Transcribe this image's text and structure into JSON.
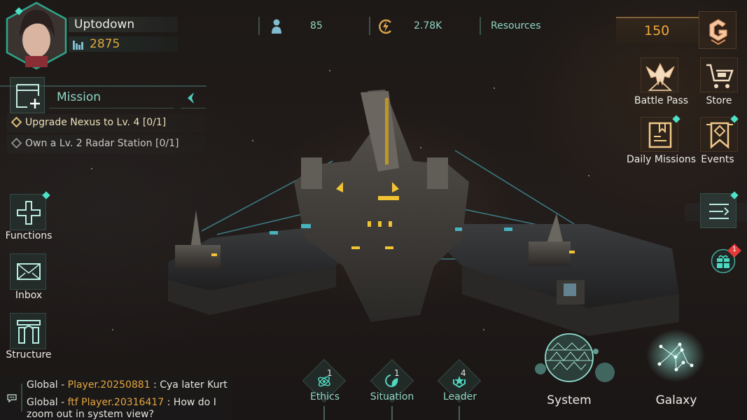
{
  "player": {
    "name": "Uptodown",
    "power": "2875",
    "avatar_icon": "commander-portrait"
  },
  "resources": [
    {
      "icon": "population-icon",
      "value": "85"
    },
    {
      "icon": "energy-icon",
      "value": "2.78K"
    },
    {
      "label": "Resources"
    }
  ],
  "currency": {
    "value": "150",
    "icon": "premium-currency-icon"
  },
  "top_right_menu": [
    {
      "label": "Battle Pass",
      "icon": "battle-pass-icon",
      "has_dot": false
    },
    {
      "label": "Store",
      "icon": "cart-icon",
      "has_dot": false
    },
    {
      "label": "Daily Missions",
      "icon": "daily-missions-icon",
      "has_dot": true
    },
    {
      "label": "Events",
      "icon": "events-icon",
      "has_dot": true
    }
  ],
  "mission_panel": {
    "title": "Mission",
    "tasks": [
      {
        "text": "Upgrade Nexus to Lv. 4 ",
        "progress": "[0/1]",
        "status": "active"
      },
      {
        "text": "Own a Lv. 2 Radar Station ",
        "progress": "[0/1]",
        "status": "inactive"
      }
    ]
  },
  "left_menu": [
    {
      "label": "Functions",
      "icon": "plus-icon",
      "has_dot": true
    },
    {
      "label": "Inbox",
      "icon": "envelope-icon",
      "has_dot": false
    },
    {
      "label": "Structure",
      "icon": "structure-icon",
      "has_dot": false
    }
  ],
  "side_menu": {
    "icon": "expand-menu-icon",
    "has_dot": true
  },
  "gift": {
    "icon": "gift-icon",
    "badge": "1"
  },
  "chat": {
    "icon": "chat-icon",
    "messages": [
      {
        "channel": "Global",
        "sender": "Player.20250881",
        "text": ": Cya later Kurt"
      },
      {
        "channel": "Global",
        "sender": "ftf Player.20316417",
        "text": ": How do I",
        "text2": "zoom out in system view?"
      }
    ]
  },
  "bottom_menu": [
    {
      "label": "Ethics",
      "count": "1",
      "icon": "ethics-icon"
    },
    {
      "label": "Situation",
      "count": "1",
      "icon": "situation-icon"
    },
    {
      "label": "Leader",
      "count": "4",
      "icon": "leader-icon"
    }
  ],
  "map_views": [
    {
      "label": "System",
      "icon": "system-sphere-icon"
    },
    {
      "label": "Galaxy",
      "icon": "galaxy-constellation-icon"
    }
  ],
  "colors": {
    "accent_teal": "#4fe0c8",
    "text_teal": "#8fd6c4",
    "gold": "#e3a63e",
    "badge_red": "#e33a3a"
  }
}
